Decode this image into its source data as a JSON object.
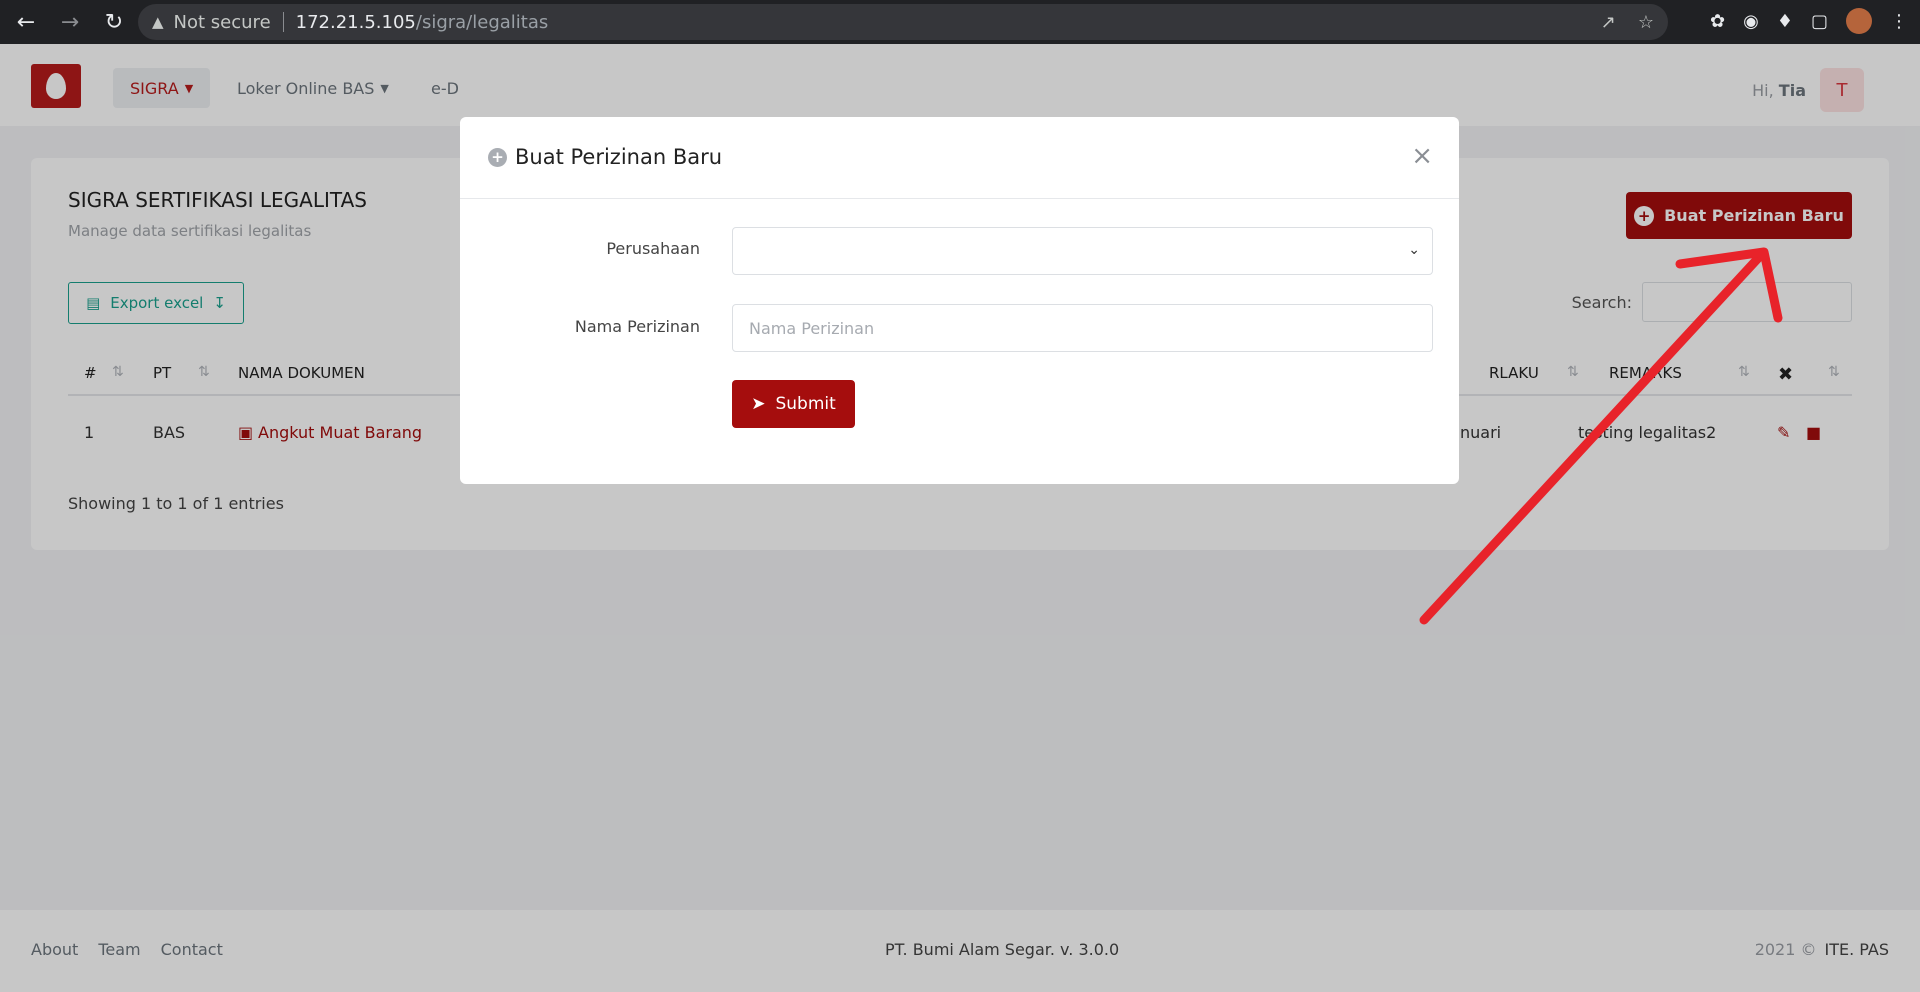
{
  "browser": {
    "not_secure": "Not secure",
    "host": "172.21.5.105",
    "path": "/sigra/legalitas"
  },
  "nav": {
    "items": [
      {
        "label": "SIGRA"
      },
      {
        "label": "Loker Online BAS"
      },
      {
        "label": "e-D"
      }
    ],
    "greeting": "Hi,",
    "user_name": "Tia",
    "avatar_initial": "T"
  },
  "page": {
    "title": "SIGRA SERTIFIKASI LEGALITAS",
    "subtitle": "Manage data sertifikasi legalitas",
    "new_button": "Buat Perizinan Baru",
    "export_button": "Export excel",
    "search_label": "Search:"
  },
  "table": {
    "headers": [
      "#",
      "PT",
      "NAMA DOKUMEN",
      "RLAKU",
      "REMARKS"
    ],
    "rows": [
      {
        "no": "1",
        "pt": "BAS",
        "doc": "Angkut Muat Barang",
        "berlaku": "nuari",
        "remarks": "testing legalitas2"
      }
    ],
    "info": "Showing 1 to 1 of 1 entries"
  },
  "modal": {
    "title": "Buat Perizinan Baru",
    "company_label": "Perusahaan",
    "name_label": "Nama Perizinan",
    "name_placeholder": "Nama Perizinan",
    "submit": "Submit"
  },
  "footer": {
    "links": [
      "About",
      "Team",
      "Contact"
    ],
    "center": "PT. Bumi Alam Segar. v. 3.0.0",
    "year": "2021 ©",
    "team": "ITE. PAS"
  },
  "colors": {
    "brand": "#a50d0d",
    "export": "#1aa08e",
    "arrow": "#e8232a"
  }
}
